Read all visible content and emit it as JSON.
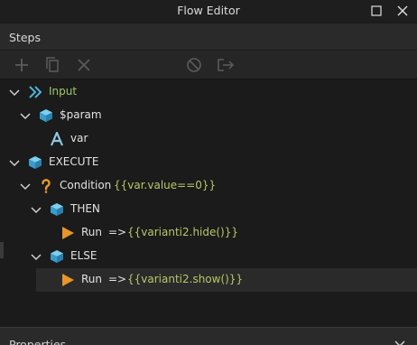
{
  "window": {
    "title": "Flow Editor"
  },
  "panel": {
    "steps_label": "Steps",
    "properties_label": "Properties"
  },
  "toolbar": {
    "icons": [
      "add-icon",
      "copy-icon",
      "delete-icon",
      "disable-icon",
      "export-icon"
    ]
  },
  "tree": {
    "input": {
      "label": "Input"
    },
    "param": {
      "label": "$param"
    },
    "var": {
      "label": "var"
    },
    "execute": {
      "label": "EXECUTE"
    },
    "condition": {
      "label": "Condition",
      "expr": "{{var.value==0}}"
    },
    "then": {
      "label": "THEN"
    },
    "run1": {
      "label": "Run",
      "arrow": "=>",
      "expr": "{{varianti2.hide()}}"
    },
    "else": {
      "label": "ELSE"
    },
    "run2": {
      "label": "Run",
      "arrow": "=>",
      "expr": "{{varianti2.show()}}"
    }
  },
  "colors": {
    "accent_green": "#9ec96a",
    "cube_blue": "#4fb3d9",
    "condition_orange": "#e89a2c",
    "run_orange": "#e8952b",
    "expression": "#b7c766"
  }
}
